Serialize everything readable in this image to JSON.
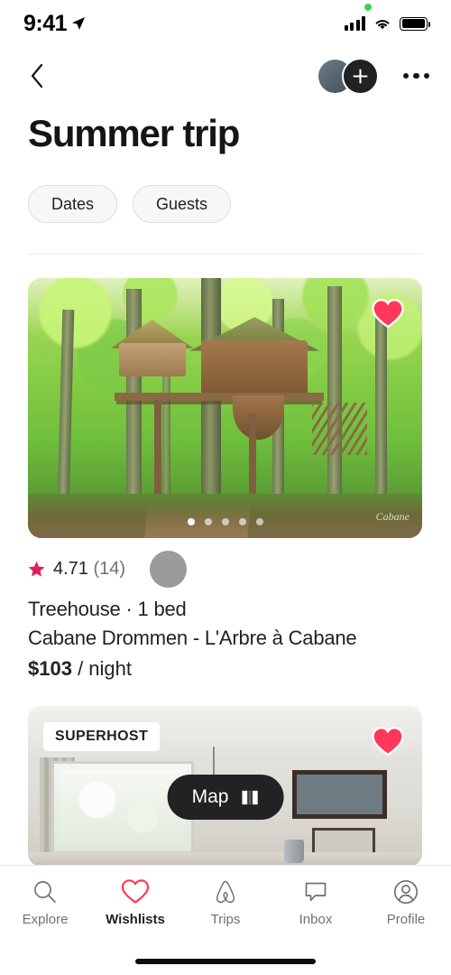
{
  "status_bar": {
    "time": "9:41",
    "location_icon": "location-arrow-icon",
    "signal_icon": "cellular-signal-icon",
    "wifi_icon": "wifi-icon",
    "battery_icon": "battery-full-icon",
    "recording_indicator": "green-recording-dot"
  },
  "nav": {
    "back_icon": "chevron-left-icon",
    "avatar": "host-avatar",
    "add_icon": "plus-icon",
    "more_icon": "more-horizontal-icon"
  },
  "header": {
    "title": "Summer trip"
  },
  "filters": [
    {
      "label": "Dates",
      "name": "filter-chip-dates"
    },
    {
      "label": "Guests",
      "name": "filter-chip-guests"
    }
  ],
  "listings": [
    {
      "photo_alt": "treehouse-in-green-forest",
      "watermark": "Cabane",
      "favorite_icon": "heart-filled-icon",
      "favorited": true,
      "carousel": {
        "total": 5,
        "active_index": 0
      },
      "rating": "4.71",
      "review_count": "(14)",
      "star_icon": "star-filled-icon",
      "type": "Treehouse · 1 bed",
      "name": "Cabane Drommen - L'Arbre à Cabane",
      "price": "$103",
      "price_unit": "/ night"
    },
    {
      "photo_alt": "bedroom-interior-with-window",
      "badge": "SUPERHOST",
      "favorite_icon": "heart-filled-icon",
      "favorited": true
    }
  ],
  "map_button": {
    "label": "Map",
    "icon": "map-folded-icon"
  },
  "tabs": [
    {
      "label": "Explore",
      "icon": "search-icon",
      "active": false
    },
    {
      "label": "Wishlists",
      "icon": "heart-icon",
      "active": true
    },
    {
      "label": "Trips",
      "icon": "airbnb-belo-icon",
      "active": false
    },
    {
      "label": "Inbox",
      "icon": "message-icon",
      "active": false
    },
    {
      "label": "Profile",
      "icon": "person-circle-icon",
      "active": false
    }
  ],
  "colors": {
    "brand_pink": "#FF385C",
    "star_pink": "#E31C5F",
    "text_primary": "#222222",
    "text_secondary": "#717171",
    "dark_pill": "#222222"
  }
}
